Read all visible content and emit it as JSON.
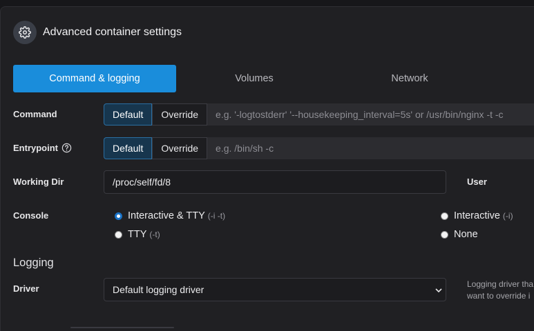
{
  "header": {
    "title": "Advanced container settings",
    "icon": "gear-icon"
  },
  "tabs": [
    {
      "label": "Command & logging",
      "active": true
    },
    {
      "label": "Volumes",
      "active": false
    },
    {
      "label": "Network",
      "active": false
    }
  ],
  "command": {
    "label": "Command",
    "default_label": "Default",
    "override_label": "Override",
    "placeholder": "e.g. '-logtostderr' '--housekeeping_interval=5s' or /usr/bin/nginx -t -c"
  },
  "entrypoint": {
    "label": "Entrypoint",
    "default_label": "Default",
    "override_label": "Override",
    "placeholder": "e.g. /bin/sh -c"
  },
  "working_dir": {
    "label": "Working Dir",
    "value": "/proc/self/fd/8"
  },
  "user": {
    "label": "User"
  },
  "console": {
    "label": "Console",
    "options": [
      {
        "label": "Interactive & TTY",
        "hint": "(-i -t)",
        "selected": true
      },
      {
        "label": "TTY",
        "hint": "(-t)",
        "selected": false
      },
      {
        "label": "Interactive",
        "hint": "(-i)",
        "selected": false
      },
      {
        "label": "None",
        "hint": "",
        "selected": false
      }
    ]
  },
  "logging": {
    "section_title": "Logging",
    "driver_label": "Driver",
    "driver_value": "Default logging driver",
    "help_line1": "Logging driver tha",
    "help_line2": "want to override i"
  },
  "colors": {
    "accent": "#1a8ddb",
    "panel": "#202023",
    "background": "#17171a"
  }
}
